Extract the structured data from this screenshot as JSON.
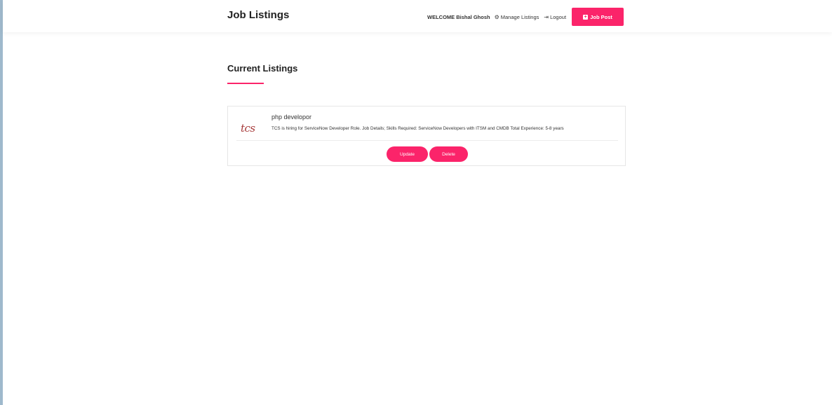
{
  "header": {
    "brand": "Job Listings",
    "welcome": "WELCOME Bishal Ghosh",
    "manage_listings_label": "Manage Listings",
    "manage_listings_icon": "gears-icon",
    "logout_label": "Logout",
    "logout_icon": "sign-out-icon",
    "job_post_label": "Job Post",
    "job_post_icon": "plus-square-icon"
  },
  "main": {
    "section_title": "Current Listings",
    "listings": [
      {
        "logo_text": "tcs",
        "title": "php developor",
        "description": "TCS is hiring for ServiceNow Developer Role. Job Details; Skills Required: ServiceNow Developers with ITSM and CMDB Total Experience: 5-8 years",
        "update_label": "Update",
        "delete_label": "Delete"
      }
    ]
  },
  "colors": {
    "accent": "#fb246a",
    "left_border": "#9fb9cc"
  }
}
